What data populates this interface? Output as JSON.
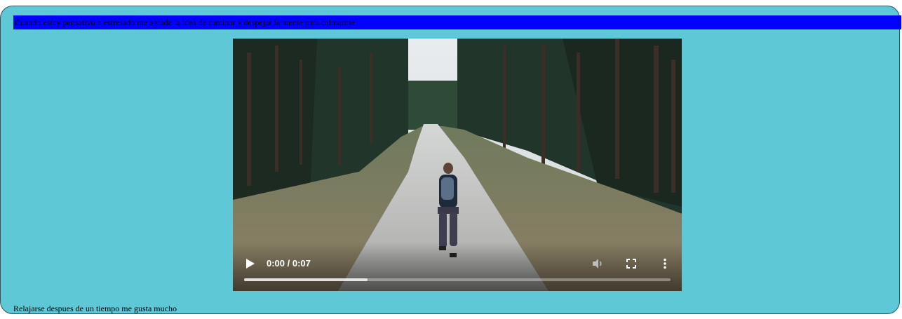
{
  "banner": {
    "text": "Cuando estoy pensativo o estresado me agrada la idea de caminar y despejar la mente para calmarme",
    "background_color": "#0000ff"
  },
  "video": {
    "time_display": "0:00 / 0:07",
    "progress_fraction": 0.29,
    "icons": [
      "play-icon",
      "volume-icon",
      "fullscreen-icon",
      "more-options-icon"
    ]
  },
  "caption": {
    "text": "Relajarse despues de un tiempo me gusta mucho"
  },
  "colors": {
    "card_background": "#5ec8d6",
    "card_border": "#2a5660"
  }
}
